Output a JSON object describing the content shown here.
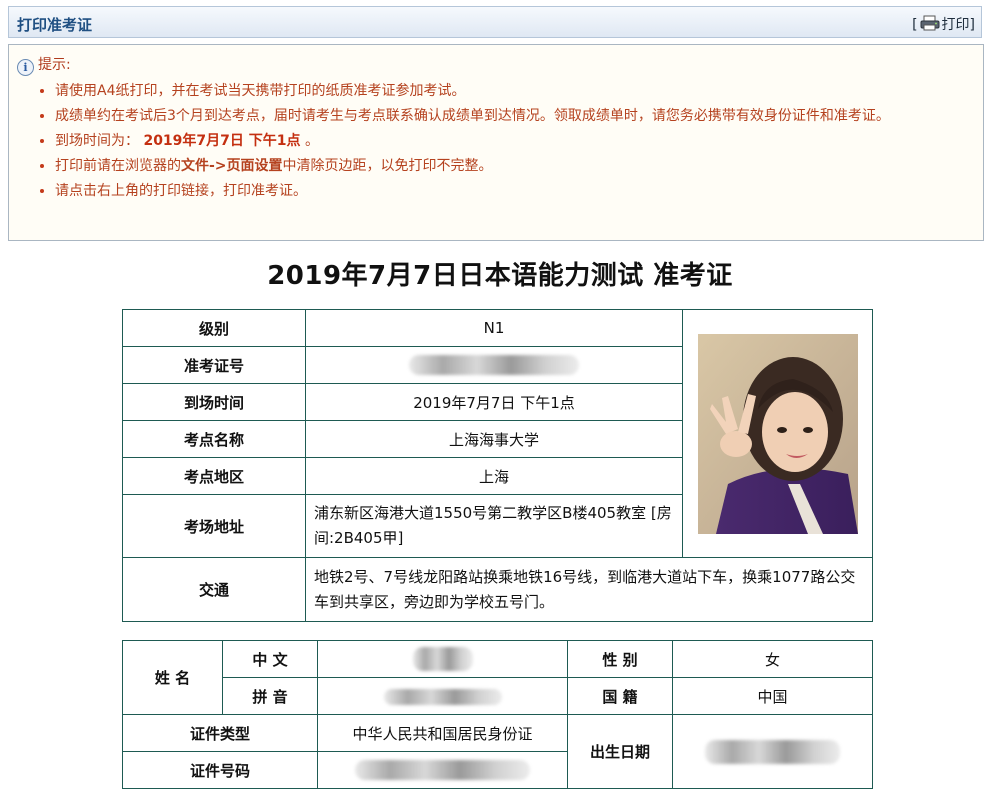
{
  "header": {
    "title": "打印准考证",
    "print_label": "打印",
    "print_bracket_left": "[",
    "print_bracket_right": "]"
  },
  "tips": {
    "heading": "提示:",
    "item1": "请使用A4纸打印，并在考试当天携带打印的纸质准考证参加考试。",
    "item2": "成绩单约在考试后3个月到达考点，届时请考生与考点联系确认成绩单到达情况。领取成绩单时，请您务必携带有效身份证件和准考证。",
    "item3_prefix": "到场时间为：",
    "item3_time": "2019年7月7日 下午1点",
    "item3_suffix": "。",
    "item4_a": "打印前请在浏览器的",
    "item4_file": "文件->",
    "item4_setup": "页面设置",
    "item4_b": "中清除页边距，以免打印不完整。",
    "item5": "请点击右上角的打印链接，打印准考证。"
  },
  "page_title": "2019年7月7日日本语能力测试 准考证",
  "exam": {
    "level_label": "级别",
    "level_value": "N1",
    "ticket_label": "准考证号",
    "arrival_label": "到场时间",
    "arrival_value": "2019年7月7日  下午1点",
    "site_label": "考点名称",
    "site_value": "上海海事大学",
    "region_label": "考点地区",
    "region_value": "上海",
    "address_label": "考场地址",
    "address_value": "浦东新区海港大道1550号第二教学区B楼405教室 [房间:2B405甲]",
    "transport_label": "交通",
    "transport_value": "地铁2号、7号线龙阳路站换乘地铁16号线，到临港大道站下车，换乘1077路公交车到共享区，旁边即为学校五号门。"
  },
  "person": {
    "name_label": "姓 名",
    "chinese_label": "中 文",
    "pinyin_label": "拼 音",
    "gender_label": "性 别",
    "gender_value": "女",
    "nationality_label": "国 籍",
    "nationality_value": "中国",
    "id_type_label": "证件类型",
    "id_type_value": "中华人民共和国居民身份证",
    "id_number_label": "证件号码",
    "birth_label": "出生日期"
  },
  "colors": {
    "accent": "#1f4f82",
    "tip_text": "#b5421f",
    "table_border": "#1e5a52"
  }
}
